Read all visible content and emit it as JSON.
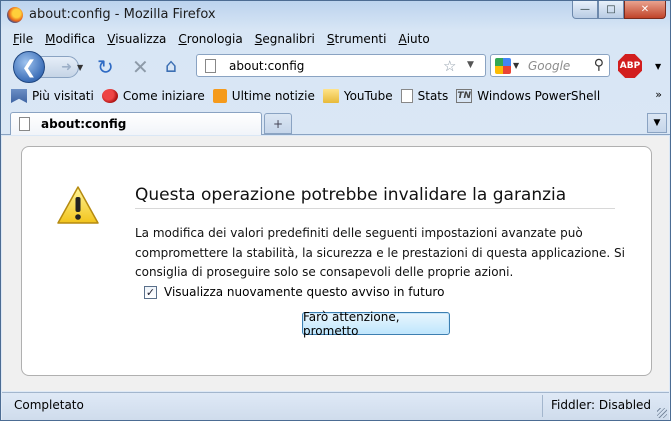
{
  "window": {
    "title": "about:config - Mozilla Firefox",
    "minimize_glyph": "—",
    "maximize_glyph": "□",
    "close_glyph": "✕"
  },
  "menu": {
    "items": [
      {
        "accel": "F",
        "rest": "ile"
      },
      {
        "accel": "M",
        "rest": "odifica"
      },
      {
        "accel": "V",
        "rest": "isualizza"
      },
      {
        "accel": "C",
        "rest": "ronologia"
      },
      {
        "accel": "S",
        "rest": "egnalibri"
      },
      {
        "accel": "S",
        "rest": "trumenti"
      },
      {
        "accel": "A",
        "rest": "iuto"
      }
    ]
  },
  "nav": {
    "url": "about:config",
    "search_placeholder": "Google",
    "abp_label": "ABP"
  },
  "bookmarks": {
    "items": [
      {
        "label": "Più visitati",
        "icon": "bookmark-folder-icon"
      },
      {
        "label": "Come iniziare",
        "icon": "firefox-icon"
      },
      {
        "label": "Ultime notizie",
        "icon": "rss-icon"
      },
      {
        "label": "YouTube",
        "icon": "folder-icon"
      },
      {
        "label": "Stats",
        "icon": "page-icon"
      },
      {
        "label": "Windows PowerShell",
        "icon": "tn-icon"
      }
    ],
    "more": "»"
  },
  "tabs": {
    "active_label": "about:config",
    "new_tab_glyph": "+"
  },
  "warning": {
    "title": "Questa operazione potrebbe invalidare la garanzia",
    "body": "La modifica dei valori predefiniti delle seguenti impostazioni avanzate può compromettere la stabilità, la sicurezza e le prestazioni di questa applicazione. Si consiglia di proseguire solo se consapevoli delle proprie azioni.",
    "checkbox_label": "Visualizza nuovamente questo avviso in futuro",
    "checkbox_checked": true,
    "button_label": "Farò attenzione, prometto"
  },
  "status": {
    "text": "Completato",
    "fiddler": "Fiddler: Disabled"
  },
  "colors": {
    "accent": "#2f6bc4",
    "abp_red": "#d21e1e"
  }
}
